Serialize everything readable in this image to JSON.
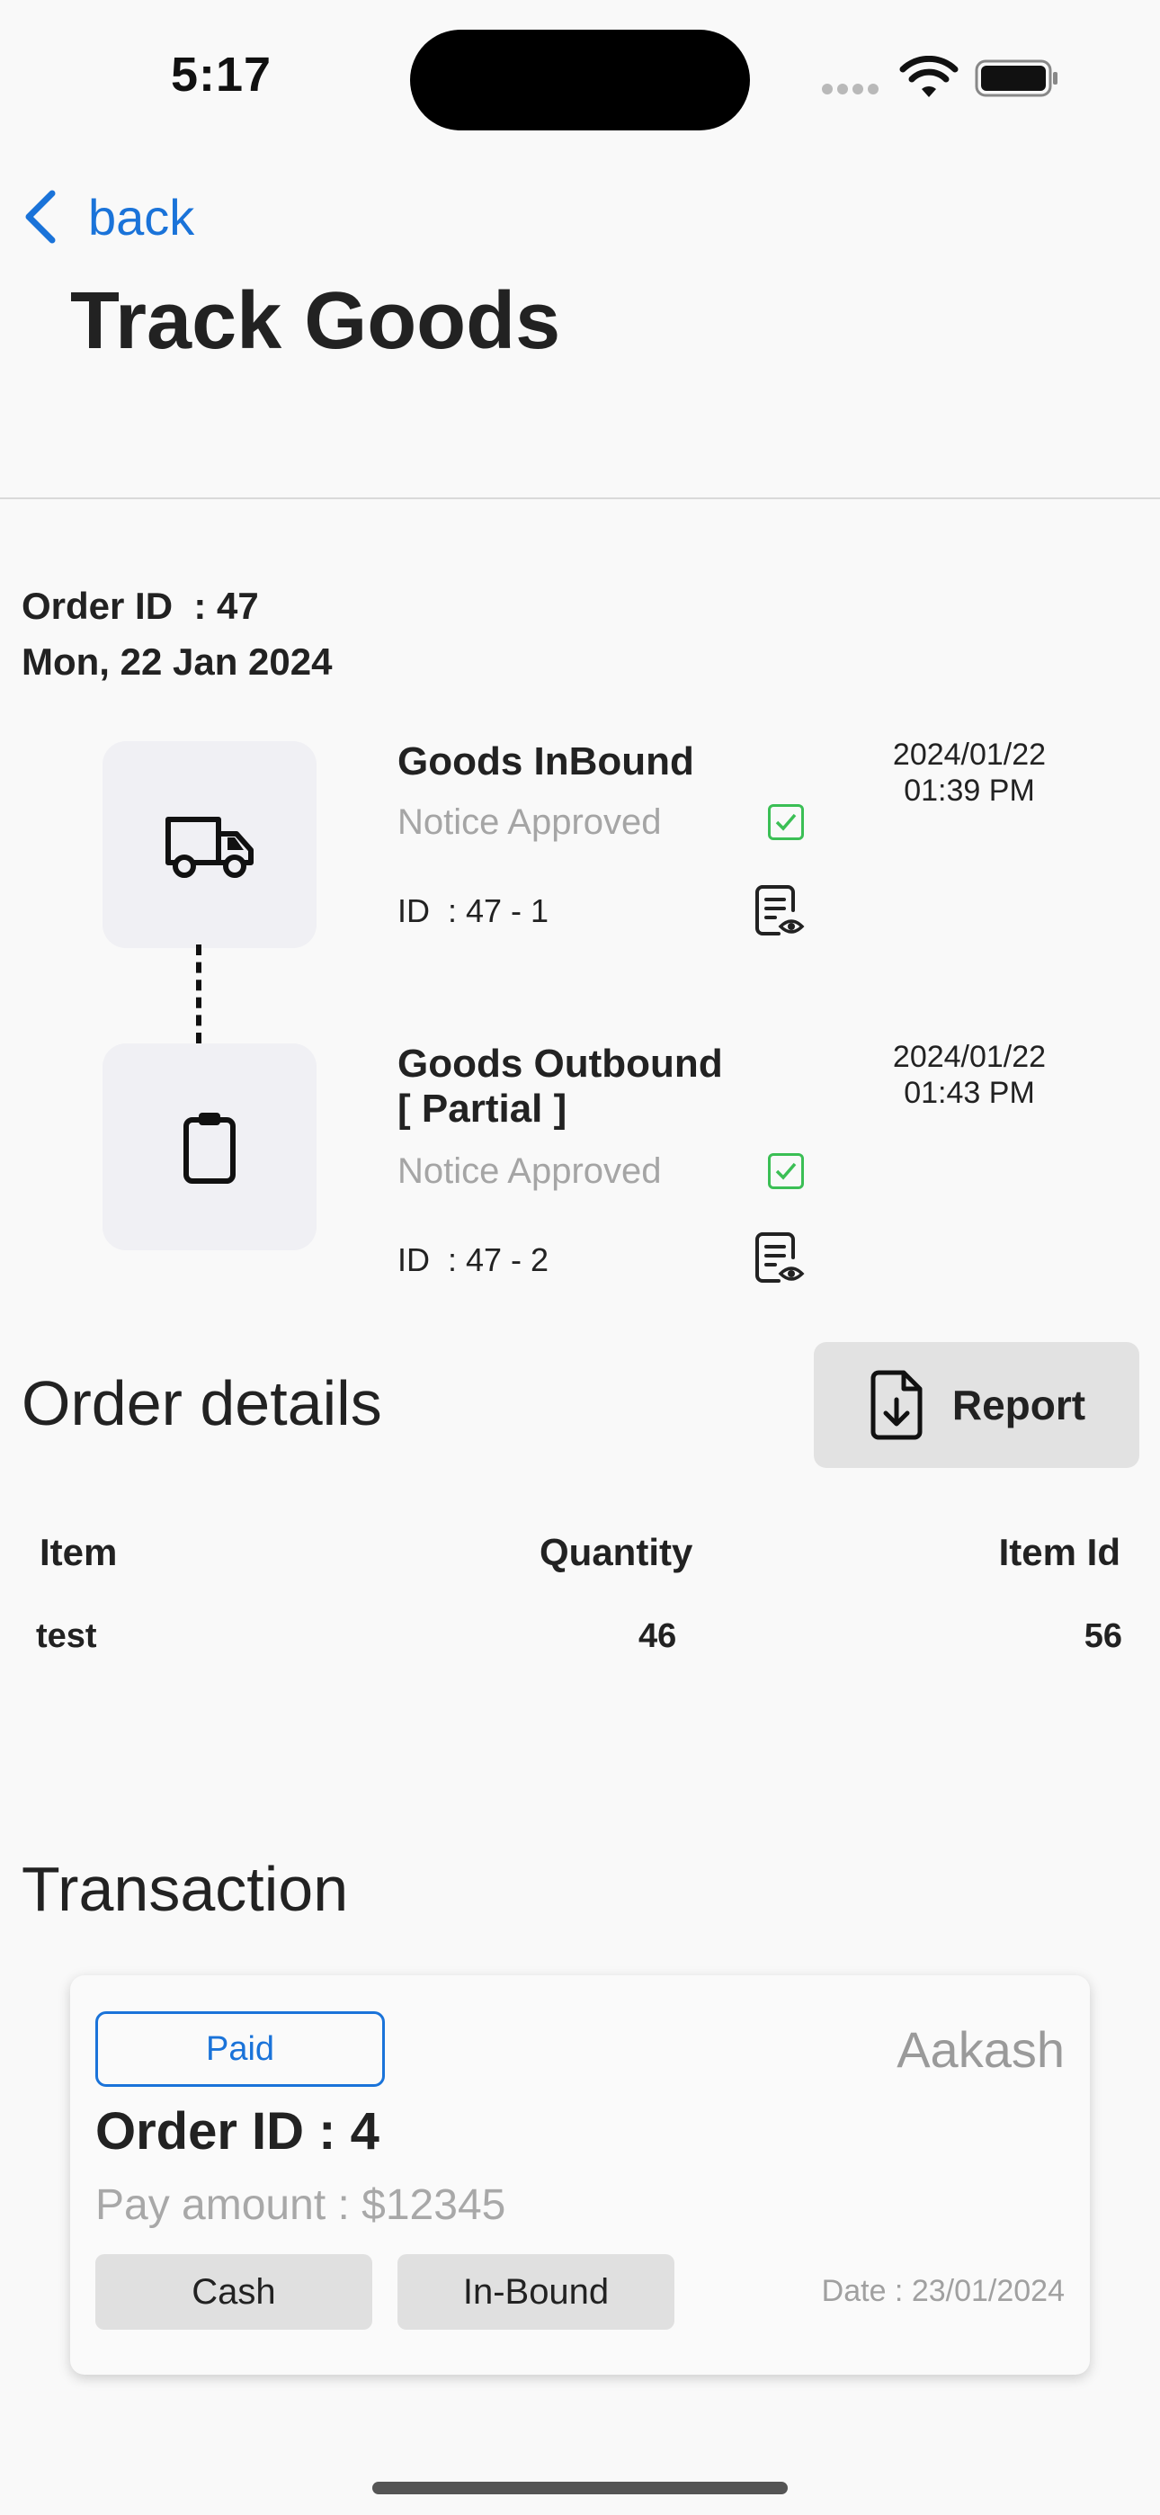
{
  "status_bar": {
    "time": "5:17"
  },
  "nav": {
    "back_label": "back",
    "title": "Track Goods"
  },
  "order": {
    "id_line": "Order ID  : 47",
    "date": "Mon, 22 Jan 2024"
  },
  "timeline": [
    {
      "icon": "truck-icon",
      "title": "Goods InBound",
      "status": "Notice Approved",
      "id_text": "ID  : 47 - 1",
      "date": "2024/01/22",
      "time": "01:39 PM"
    },
    {
      "icon": "clipboard-icon",
      "title_line1": "Goods Outbound",
      "title_line2": "[ Partial ]",
      "status": "Notice Approved",
      "id_text": "ID  : 47 - 2",
      "date": "2024/01/22",
      "time": "01:43 PM"
    }
  ],
  "order_details": {
    "title": "Order details",
    "report_label": "Report",
    "columns": [
      "Item",
      "Quantity",
      "Item Id"
    ],
    "rows": [
      {
        "item": "test",
        "quantity": "46",
        "item_id": "56"
      }
    ]
  },
  "transaction": {
    "title": "Transaction",
    "status": "Paid",
    "payer": "Aakash",
    "order_id": "Order ID : 4",
    "amount": "Pay amount : $12345",
    "method": "Cash",
    "direction": "In-Bound",
    "date": "Date : 23/01/2024"
  },
  "colors": {
    "accent": "#1a73d9",
    "approved": "#3bbf55",
    "muted": "#a5a5a5",
    "background": "#f9f9f9"
  }
}
